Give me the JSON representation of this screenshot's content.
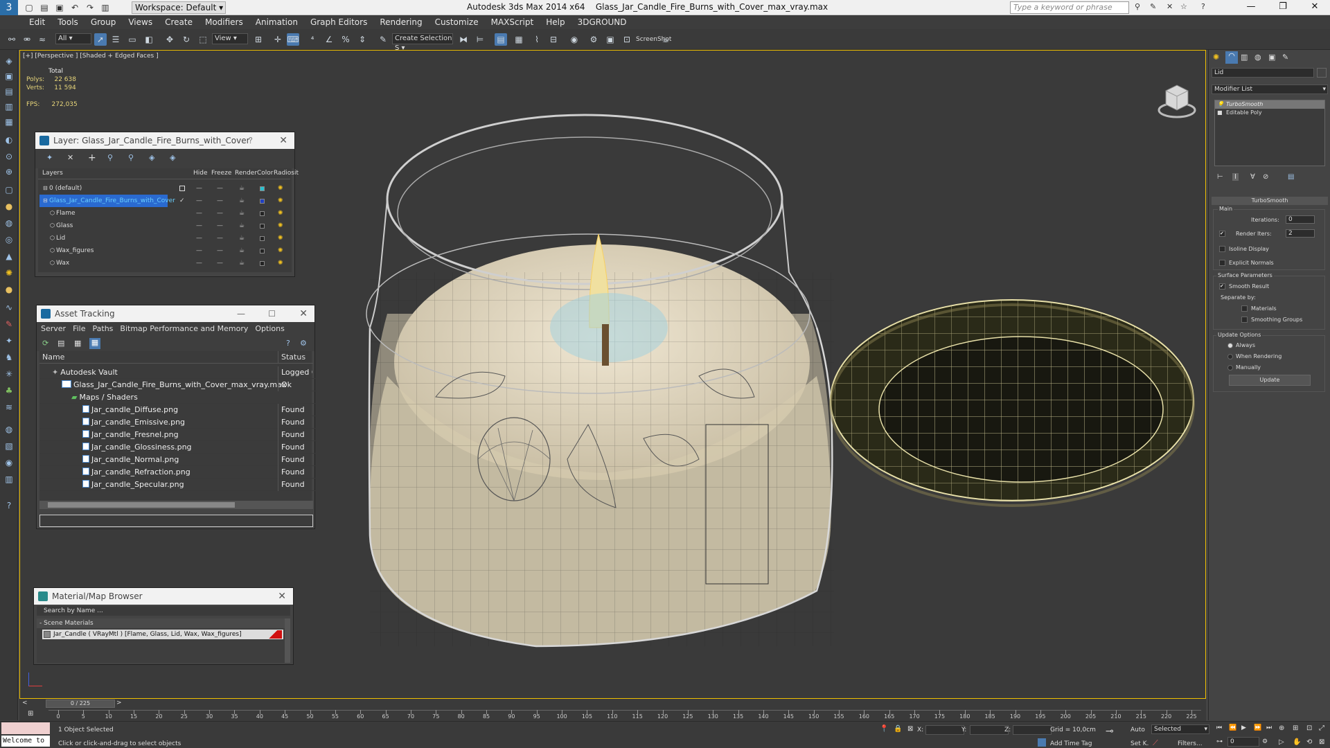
{
  "app": {
    "title": "Autodesk 3ds Max  2014 x64",
    "file": "Glass_Jar_Candle_Fire_Burns_with_Cover_max_vray.max",
    "workspace": "Workspace: Default",
    "search_placeholder": "Type a keyword or phrase"
  },
  "menu": [
    "Edit",
    "Tools",
    "Group",
    "Views",
    "Create",
    "Modifiers",
    "Animation",
    "Graph Editors",
    "Rendering",
    "Customize",
    "MAXScript",
    "Help",
    "3DGROUND"
  ],
  "toolbar": {
    "filter": "All",
    "view": "View",
    "selection_set": "Create Selection S",
    "screenshot": "ScreenShot"
  },
  "viewport": {
    "label": "[+] [Perspective ] [Shaded + Edged Faces ]",
    "stats": {
      "total_label": "Total",
      "polys_label": "Polys:",
      "polys": "22 638",
      "verts_label": "Verts:",
      "verts": "11 594",
      "fps_label": "FPS:",
      "fps": "272,035"
    }
  },
  "layer_panel": {
    "title": "Layer: Glass_Jar_Candle_Fire_Burns_with_Cover",
    "columns": [
      "Layers",
      "Hide",
      "Freeze",
      "Render",
      "Color",
      "Radiosit"
    ],
    "rows": [
      {
        "name": "0 (default)",
        "color": "#2ac0d0"
      },
      {
        "name": "Glass_Jar_Candle_Fire_Burns_with_Cover",
        "color": "#2040c0"
      },
      {
        "name": "Flame",
        "color": "#222222"
      },
      {
        "name": "Glass",
        "color": "#222222"
      },
      {
        "name": "Lid",
        "color": "#222222"
      },
      {
        "name": "Wax_figures",
        "color": "#222222"
      },
      {
        "name": "Wax",
        "color": "#222222"
      }
    ]
  },
  "asset_tracking": {
    "title": "Asset Tracking",
    "menu": [
      "Server",
      "File",
      "Paths",
      "Bitmap Performance and Memory",
      "Options"
    ],
    "col_name": "Name",
    "col_status": "Status",
    "rows": [
      {
        "name": "Autodesk Vault",
        "status": "Logged O"
      },
      {
        "name": "Glass_Jar_Candle_Fire_Burns_with_Cover_max_vray.max",
        "status": "Ok"
      },
      {
        "name": "Maps / Shaders",
        "status": ""
      },
      {
        "name": "Jar_candle_Diffuse.png",
        "status": "Found"
      },
      {
        "name": "Jar_candle_Emissive.png",
        "status": "Found"
      },
      {
        "name": "Jar_candle_Fresnel.png",
        "status": "Found"
      },
      {
        "name": "Jar_candle_Glossiness.png",
        "status": "Found"
      },
      {
        "name": "Jar_candle_Normal.png",
        "status": "Found"
      },
      {
        "name": "Jar_candle_Refraction.png",
        "status": "Found"
      },
      {
        "name": "Jar_candle_Specular.png",
        "status": "Found"
      }
    ]
  },
  "material_browser": {
    "title": "Material/Map Browser",
    "search": "Search by Name ...",
    "section": "- Scene Materials",
    "item": "Jar_Candle  ( VRayMtl ) [Flame, Glass, Lid, Wax, Wax_figures]"
  },
  "command_panel": {
    "object_name": "Lid",
    "modifier_list": "Modifier List",
    "stack": [
      "TurboSmooth",
      "Editable Poly"
    ],
    "rollout_title": "TurboSmooth",
    "main": "Main",
    "iterations_label": "Iterations:",
    "iterations": "0",
    "render_iters_label": "Render Iters:",
    "render_iters": "2",
    "isoline": "Isoline Display",
    "explicit_normals": "Explicit Normals",
    "surface_params": "Surface Parameters",
    "smooth_result": "Smooth Result",
    "separate_by": "Separate by:",
    "materials": "Materials",
    "smoothing_groups": "Smoothing Groups",
    "update_options": "Update Options",
    "always": "Always",
    "when_rendering": "When Rendering",
    "manually": "Manually",
    "update_button": "Update"
  },
  "timeline": {
    "frame": "0 / 225",
    "ticks": [
      "0",
      "5",
      "10",
      "15",
      "20",
      "25",
      "30",
      "35",
      "40",
      "45",
      "50",
      "55",
      "60",
      "65",
      "70",
      "75",
      "80",
      "85",
      "90",
      "95",
      "100",
      "105",
      "110",
      "115",
      "120",
      "125",
      "130",
      "135",
      "140",
      "145",
      "150",
      "155",
      "160",
      "165",
      "170",
      "175",
      "180",
      "185",
      "190",
      "195",
      "200",
      "205",
      "210",
      "215",
      "220",
      "225"
    ]
  },
  "status": {
    "welcome": "Welcome to",
    "selected": "1 Object Selected",
    "hint": "Click or click-and-drag to select objects",
    "x_label": "X:",
    "y_label": "Y:",
    "z_label": "Z:",
    "grid": "Grid = 10,0cm",
    "add_time_tag": "Add Time Tag",
    "auto": "Auto",
    "set_key": "Set K.",
    "selected_dd": "Selected",
    "filters": "Filters...",
    "frame_field": "0"
  }
}
